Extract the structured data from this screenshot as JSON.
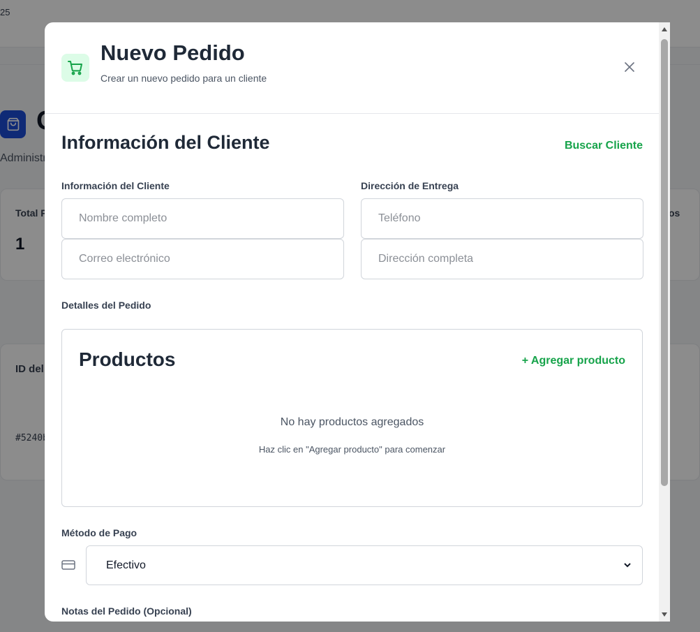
{
  "background": {
    "top_text": "25",
    "title": "G",
    "subtitle": "Administr",
    "stat_label": "Total P",
    "stat_value": "1",
    "stat_right": "os",
    "table_header": "ID del",
    "order_id": "#5240b"
  },
  "modal": {
    "title": "Nuevo Pedido",
    "subtitle": "Crear un nuevo pedido para un cliente",
    "header_icon": "shopping-cart-icon",
    "close_icon": "close-icon",
    "accent_color": "#16a34a"
  },
  "customer": {
    "section_title": "Información del Cliente",
    "search_label": "Buscar Cliente",
    "left_label": "Información del Cliente",
    "right_label": "Dirección de Entrega",
    "name_placeholder": "Nombre completo",
    "email_placeholder": "Correo electrónico",
    "phone_placeholder": "Teléfono",
    "address_placeholder": "Dirección completa"
  },
  "order": {
    "details_label": "Detalles del Pedido",
    "products_title": "Productos",
    "add_product_label": "+ Agregar producto",
    "empty_title": "No hay productos agregados",
    "empty_hint": "Haz clic en \"Agregar producto\" para comenzar"
  },
  "payment": {
    "label": "Método de Pago",
    "icon": "credit-card-icon",
    "selected": "Efectivo"
  },
  "notes": {
    "label": "Notas del Pedido (Opcional)"
  }
}
